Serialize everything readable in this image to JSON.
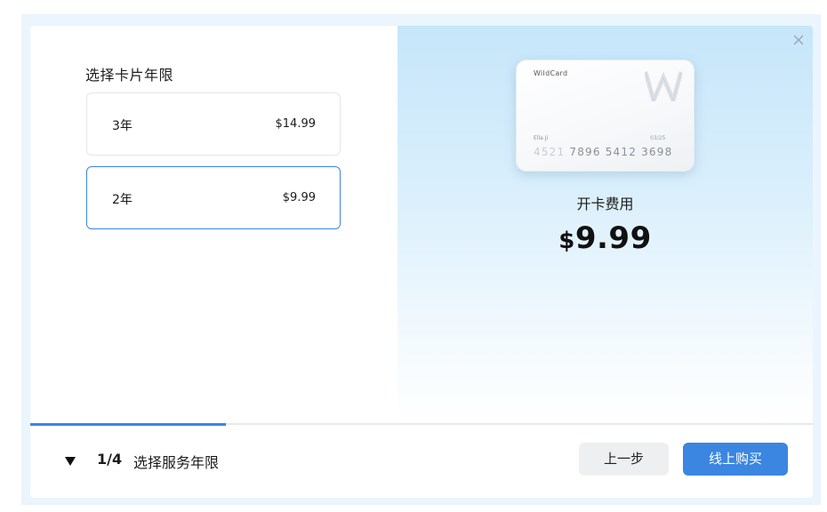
{
  "left": {
    "title": "选择卡片年限",
    "options": [
      {
        "years": "3年",
        "price": "$14.99",
        "selected": false
      },
      {
        "years": "2年",
        "price": "$9.99",
        "selected": true
      }
    ]
  },
  "card": {
    "brand": "WildCard",
    "logo_letter": "W",
    "holder": "Ella Ji",
    "expiry": "03/25",
    "number_faded": "4521",
    "number": "7896 5412 3698"
  },
  "fee": {
    "label": "开卡费用",
    "currency": "$",
    "amount": "9.99"
  },
  "progress": {
    "fraction": 0.25
  },
  "footer": {
    "step": "1/4",
    "step_title": "选择服务年限",
    "prev_label": "上一步",
    "buy_label": "线上购买"
  },
  "colors": {
    "accent": "#3a86e0",
    "backdrop": "#eaf5fd"
  }
}
